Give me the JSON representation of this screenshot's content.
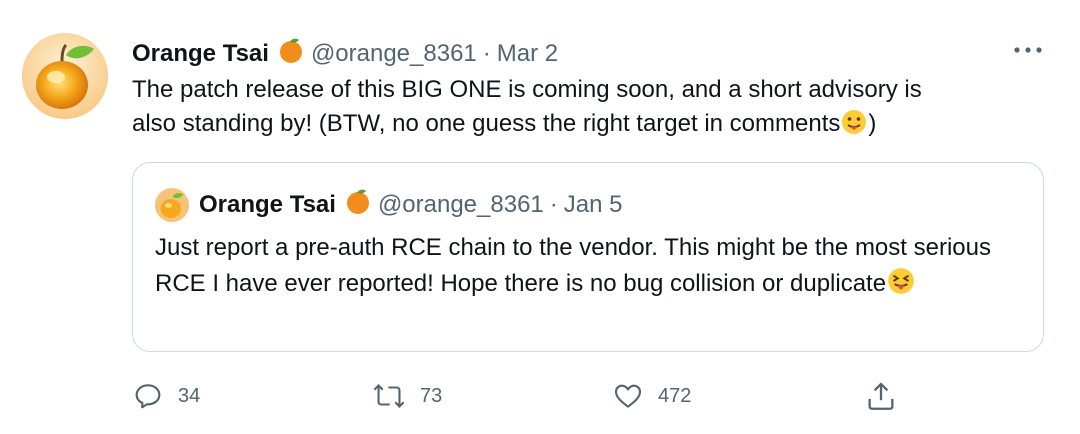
{
  "tweet": {
    "author_name": "Orange Tsai",
    "handle": "@orange_8361",
    "separator": "·",
    "date": "Mar 2",
    "text": "The patch release of this BIG ONE is coming soon, and a short advisory is\nalso standing by! (BTW, no one guess the right target in comments",
    "text_tail": ")",
    "avatar_icon": "orange-avatar",
    "name_emoji_icon": "orange-emoji",
    "text_emoji_icon": "tongue-out-emoji"
  },
  "quoted": {
    "author_name": "Orange Tsai",
    "handle": "@orange_8361",
    "separator": "·",
    "date": "Jan 5",
    "text": "Just report a pre-auth RCE chain to the vendor. This might be the most serious RCE I have ever reported! Hope there is no bug collision or duplicate",
    "text_emoji_icon": "squinting-tongue-emoji"
  },
  "actions": {
    "reply_count": "34",
    "retweet_count": "73",
    "like_count": "472",
    "reply_icon": "reply-icon",
    "retweet_icon": "retweet-icon",
    "like_icon": "heart-icon",
    "share_icon": "share-icon",
    "more_icon": "more-icon"
  },
  "colors": {
    "text": "#0f1419",
    "secondary": "#536471",
    "border": "#cfd9de",
    "orange": "#f28c1c"
  }
}
